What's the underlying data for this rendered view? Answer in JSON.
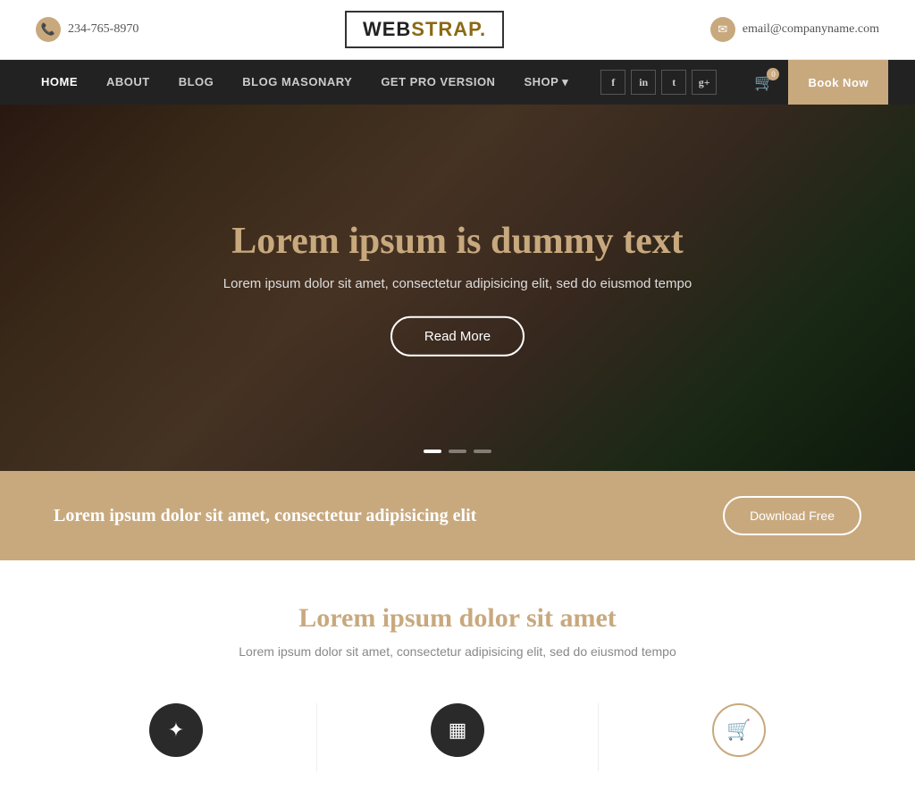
{
  "site": {
    "logo": {
      "part1": "WEB",
      "part2": "STRAP."
    }
  },
  "topbar": {
    "phone": "234-765-8970",
    "email": "email@companyname.com"
  },
  "nav": {
    "links": [
      {
        "label": "HOME",
        "active": true
      },
      {
        "label": "ABOUT",
        "active": false
      },
      {
        "label": "BLOG",
        "active": false
      },
      {
        "label": "BLOG MASONARY",
        "active": false
      },
      {
        "label": "GET PRO VERSION",
        "active": false
      },
      {
        "label": "SHOP",
        "active": false,
        "hasDropdown": true
      }
    ],
    "social": [
      {
        "label": "f",
        "name": "facebook"
      },
      {
        "label": "in",
        "name": "linkedin"
      },
      {
        "label": "t",
        "name": "twitter"
      },
      {
        "label": "g+",
        "name": "googleplus"
      }
    ],
    "cart_count": "0",
    "book_now": "Book Now"
  },
  "hero": {
    "title_plain": "Lorem ipsum is ",
    "title_accent": "dummy text",
    "subtitle": "Lorem ipsum dolor sit amet, consectetur adipisicing elit, sed do eiusmod tempo",
    "cta_label": "Read More",
    "dots": [
      {
        "active": true
      },
      {
        "active": false
      },
      {
        "active": false
      }
    ]
  },
  "banner": {
    "text": "Lorem ipsum dolor sit amet, consectetur adipisicing elit",
    "button_label": "Download Free"
  },
  "section": {
    "title_plain": "Lorem ipsum dolor ",
    "title_accent": "sit amet",
    "subtitle": "Lorem ipsum dolor sit amet, consectetur adipisicing elit, sed do eiusmod tempo"
  },
  "features": [
    {
      "icon": "✦",
      "circle_type": "dark"
    },
    {
      "icon": "▦",
      "circle_type": "dark"
    },
    {
      "icon": "🛒",
      "circle_type": "gold"
    }
  ]
}
